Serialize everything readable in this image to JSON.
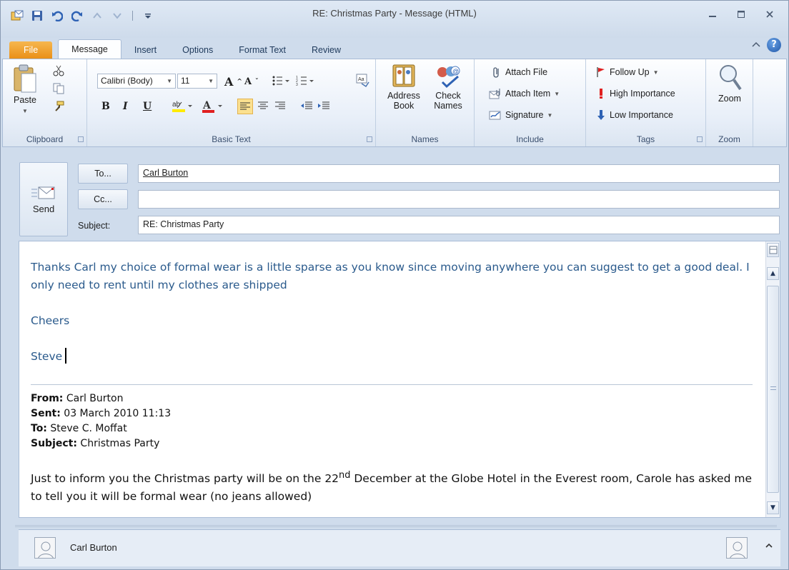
{
  "window": {
    "title": "RE: Christmas Party  -  Message (HTML)"
  },
  "tabs": [
    {
      "label": "File"
    },
    {
      "label": "Message"
    },
    {
      "label": "Insert"
    },
    {
      "label": "Options"
    },
    {
      "label": "Format Text"
    },
    {
      "label": "Review"
    }
  ],
  "ribbon": {
    "clipboard": {
      "paste_label": "Paste",
      "group_label": "Clipboard"
    },
    "basic_text": {
      "font_name": "Calibri (Body)",
      "font_size": "11",
      "bold": "B",
      "italic": "I",
      "underline": "U",
      "group_label": "Basic Text"
    },
    "names": {
      "address_book_label": "Address\nBook",
      "check_names_label": "Check\nNames",
      "group_label": "Names"
    },
    "include": {
      "attach_file_label": "Attach File",
      "attach_item_label": "Attach Item",
      "signature_label": "Signature",
      "group_label": "Include"
    },
    "tags": {
      "follow_up_label": "Follow Up",
      "high_importance_label": "High Importance",
      "low_importance_label": "Low Importance",
      "group_label": "Tags"
    },
    "zoom": {
      "zoom_label": "Zoom",
      "group_label": "Zoom"
    }
  },
  "header": {
    "send_label": "Send",
    "to_button": "To...",
    "cc_button": "Cc...",
    "subject_label": "Subject:",
    "to_value": "Carl Burton",
    "cc_value": "",
    "subject_value": "RE: Christmas Party"
  },
  "body": {
    "reply_text": "Thanks Carl my choice of formal wear is a little sparse as you know since moving anywhere you can suggest to get a good deal. I only need to rent until my clothes are shipped",
    "closing": "Cheers",
    "signature": "Steve",
    "quoted": {
      "from_label": "From:",
      "from_value": "Carl Burton",
      "sent_label": "Sent:",
      "sent_value": "03 March 2010 11:13",
      "to_label": "To:",
      "to_value": "Steve C. Moffat",
      "subject_label": "Subject:",
      "subject_value": "Christmas Party",
      "text_before": "Just to inform you the Christmas party will be on the 22",
      "sup": "nd",
      "text_after": " December at the Globe Hotel in the Everest room, Carole has asked me to tell you it will be formal wear (no jeans allowed)"
    }
  },
  "people_pane": {
    "contact_name": "Carl Burton"
  }
}
